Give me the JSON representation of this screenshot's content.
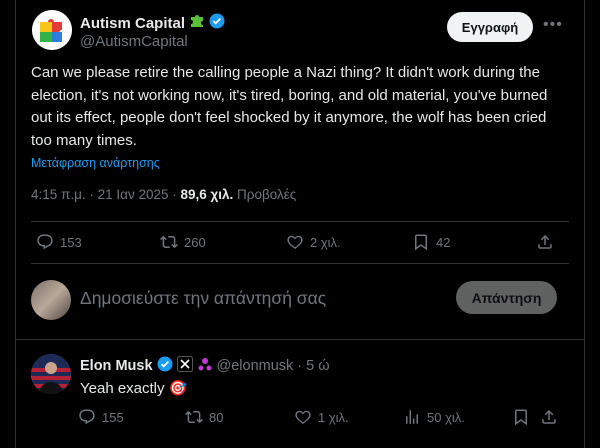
{
  "author": {
    "name": "Autism Capital",
    "handle": "@AutismCapital",
    "follow_label": "Εγγραφή"
  },
  "tweet": {
    "text": "Can we please retire the calling people a Nazi thing? It didn't work during the election, it's not working now, it's tired, boring, and old material, you've burned out its effect, people don't feel shocked by it anymore, the wolf has been cried too many times.",
    "translate_label": "Μετάφραση ανάρτησης",
    "time": "4:15 π.μ. · 21 Ιαν 2025 · ",
    "views": "89,6 χιλ.",
    "views_label": " Προβολές",
    "stats": {
      "replies": "153",
      "reposts": "260",
      "likes": "2 χιλ.",
      "bookmarks": "42"
    }
  },
  "composer": {
    "placeholder": "Δημοσιεύστε την απάντησή σας",
    "reply_label": "Απάντηση"
  },
  "reply": {
    "name": "Elon Musk",
    "handle": "@elonmusk",
    "time": "· 5 ώ",
    "text": "Yeah exactly",
    "emoji": "🎯",
    "stats": {
      "replies": "155",
      "reposts": "80",
      "likes": "1 χιλ.",
      "views": "50 χιλ."
    }
  },
  "colors": {
    "accent": "#1d9bf0",
    "verified": "#1d9bf0",
    "gold": "#e2b719",
    "muted": "#71767b",
    "border": "#2f3336"
  }
}
